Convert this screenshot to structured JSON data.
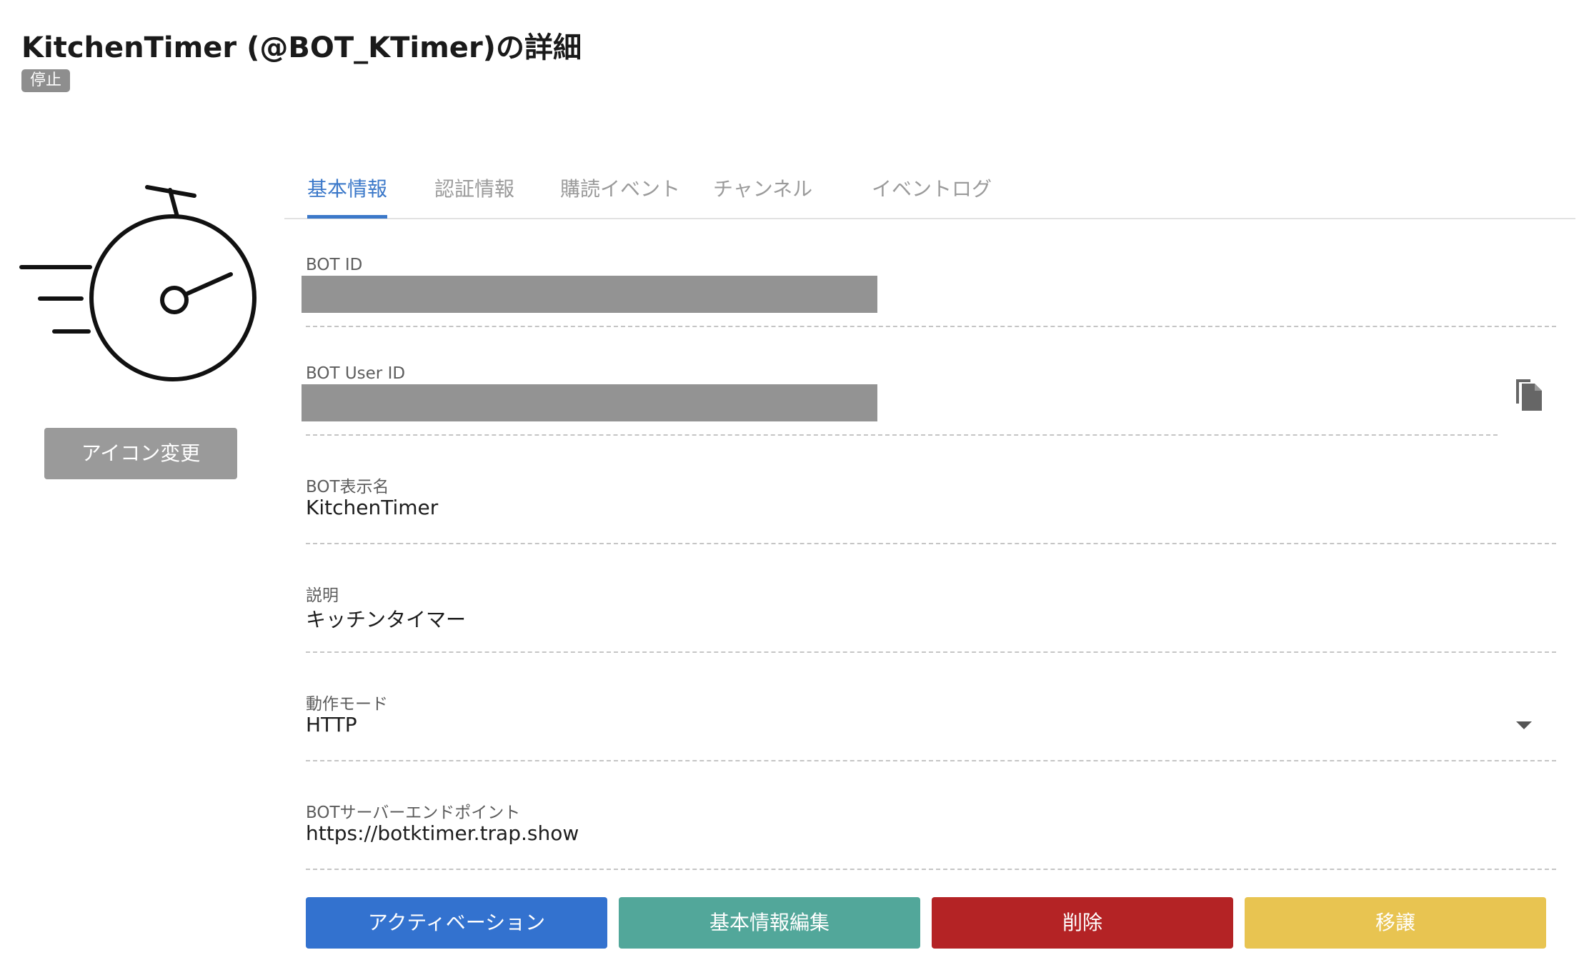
{
  "header": {
    "title": "KitchenTimer (@BOT_KTimer)の詳細",
    "status": "停止"
  },
  "sidebar": {
    "avatar_icon": "stopwatch-icon",
    "change_icon_label": "アイコン変更"
  },
  "tabs": [
    {
      "label": "基本情報",
      "active": true
    },
    {
      "label": "認証情報",
      "active": false
    },
    {
      "label": "購読イベント",
      "active": false
    },
    {
      "label": "チャンネル",
      "active": false
    },
    {
      "label": "イベントログ",
      "active": false
    }
  ],
  "fields": {
    "bot_id": {
      "label": "BOT ID",
      "value": ""
    },
    "bot_user_id": {
      "label": "BOT User ID",
      "value": "",
      "copy_icon": "copy-icon"
    },
    "display_name": {
      "label": "BOT表示名",
      "value": "KitchenTimer"
    },
    "description": {
      "label": "説明",
      "value": "キッチンタイマー"
    },
    "mode": {
      "label": "動作モード",
      "value": "HTTP",
      "dropdown_icon": "caret-down-icon"
    },
    "endpoint": {
      "label": "BOTサーバーエンドポイント",
      "value": "https://botktimer.trap.show"
    }
  },
  "actions": {
    "activate": {
      "label": "アクティベーション",
      "color": "#3372cf"
    },
    "edit": {
      "label": "基本情報編集",
      "color": "#52a79a"
    },
    "delete": {
      "label": "削除",
      "color": "#b42325"
    },
    "transfer": {
      "label": "移譲",
      "color": "#e8c451"
    }
  },
  "colors": {
    "accent": "#3b78c9",
    "status_badge": "#8e8e8e",
    "redaction": "#939393"
  }
}
